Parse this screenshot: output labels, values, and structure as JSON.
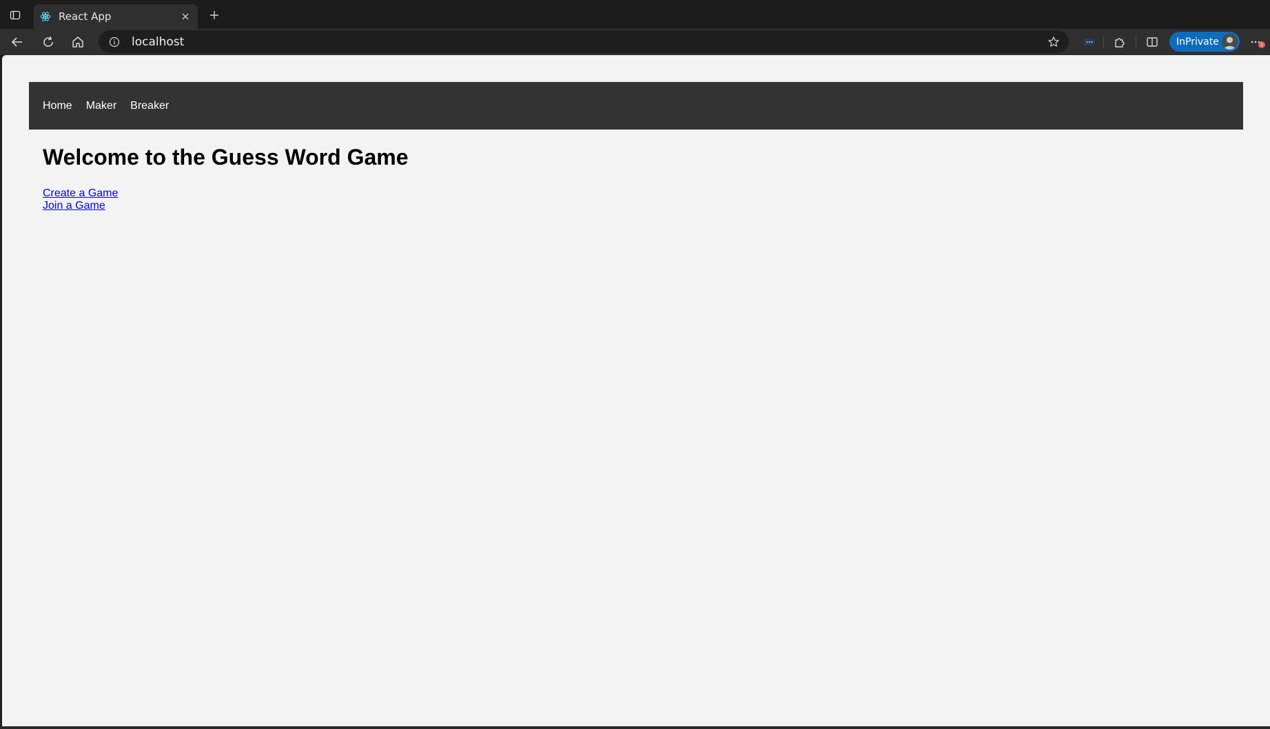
{
  "browser": {
    "tab": {
      "title": "React App",
      "favicon": "react-icon"
    },
    "address": {
      "url": "localhost"
    },
    "profile": {
      "label": "InPrivate"
    },
    "notification_count": "1",
    "icons": {
      "tab_actions": "tab-actions-icon",
      "close_tab": "close-icon",
      "new_tab": "plus-icon",
      "back": "back-arrow-icon",
      "refresh": "refresh-icon",
      "home": "home-icon",
      "site_info": "info-icon",
      "favorite": "star-icon",
      "extension": "extension-icon",
      "extensions": "puzzle-icon",
      "split_screen": "split-screen-icon",
      "more": "more-icon"
    },
    "colors": {
      "inprivate": "#0f6cbd",
      "toolbar": "#2f2f2f",
      "tabbar": "#1c1c1c"
    }
  },
  "page": {
    "nav": {
      "items": [
        {
          "label": "Home"
        },
        {
          "label": "Maker"
        },
        {
          "label": "Breaker"
        }
      ]
    },
    "heading": "Welcome to the Guess Word Game",
    "links": [
      {
        "label": "Create a Game"
      },
      {
        "label": "Join a Game"
      }
    ],
    "colors": {
      "navbar": "#333333",
      "background": "#f3f3f3",
      "link": "#0000ee"
    }
  }
}
